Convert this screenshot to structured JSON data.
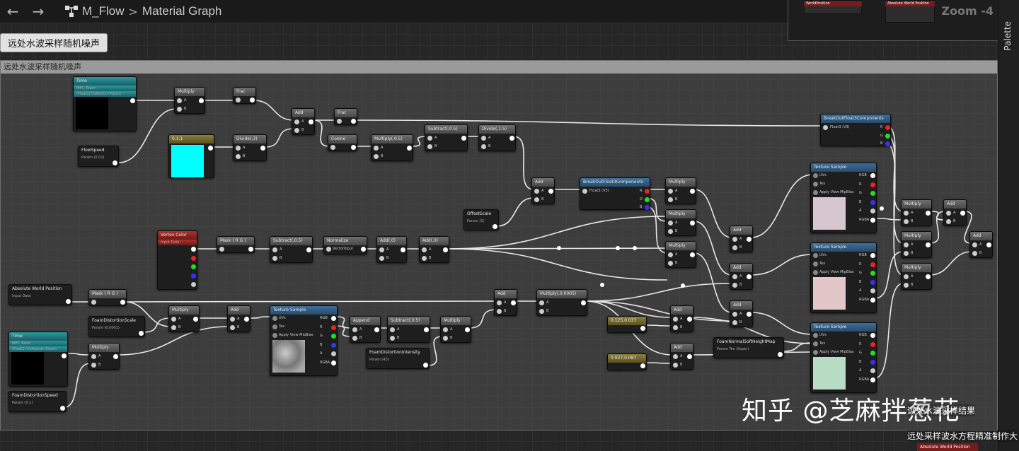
{
  "header": {
    "back_icon": "arrow-left-icon",
    "forward_icon": "arrow-right-icon",
    "graph_icon": "material-graph-icon",
    "asset_name": "M_Flow",
    "separator": ">",
    "graph_name": "Material Graph"
  },
  "minimap": {
    "zoom": "Zoom -4",
    "node_a": "WorldPosition",
    "node_b": "Absolute World Position"
  },
  "palette": {
    "label": "Palette"
  },
  "bookmark": {
    "label": "远处水波采样随机噪声"
  },
  "comment": {
    "title": "远处水波采样随机噪声"
  },
  "nodes": {
    "time1": {
      "title": "Time",
      "sub": "MPC_River",
      "sub2": "(Float1) Collection Param"
    },
    "flowspeed": {
      "title": "FlowSpeed",
      "sub": "Param (0.01)"
    },
    "color1": {
      "title": "0,1,1"
    },
    "multiply1": {
      "title": "Multiply",
      "a": "A",
      "b": "B"
    },
    "frac1": {
      "title": "Frac"
    },
    "divide1": {
      "title": "Divide(,3)",
      "a": "A",
      "b": "B"
    },
    "add1": {
      "title": "Add",
      "a": "A",
      "b": "B"
    },
    "frac2": {
      "title": "Frac"
    },
    "cosine": {
      "title": "Cosine"
    },
    "multiply05": {
      "title": "Multiply(,0.5)",
      "a": "A",
      "b": "B"
    },
    "subtract05": {
      "title": "Subtract(,0.5)",
      "a": "A",
      "b": "B"
    },
    "divide15": {
      "title": "Divide(,1.5)",
      "a": "A",
      "b": "B"
    },
    "add2": {
      "title": "Add",
      "a": "A",
      "b": "B"
    },
    "offsetscale": {
      "title": "OffsetScale",
      "sub": "Param (1)"
    },
    "breakout1": {
      "title": "BreakOutFloat3Components",
      "in": "Float3 (V3)",
      "r": "R",
      "g": "G",
      "b": "B"
    },
    "breakout2": {
      "title": "BreakOutFloat3Components",
      "in": "Float3 (V3)",
      "r": "R",
      "g": "G",
      "b": "B"
    },
    "vertexcolor": {
      "title": "Vertex Color",
      "sub": "Input Data"
    },
    "maskrg": {
      "title": "Mask ( R G )"
    },
    "subtract05b": {
      "title": "Subtract(,0.5)",
      "a": "A",
      "b": "B"
    },
    "normalize": {
      "title": "Normalize",
      "in": "VectorInput"
    },
    "add0a": {
      "title": "Add(,0)",
      "a": "A",
      "b": "B"
    },
    "add0b": {
      "title": "Add(,0)",
      "a": "A",
      "b": "B"
    },
    "multiply_r1": {
      "title": "Multiply",
      "a": "A",
      "b": "B"
    },
    "multiply_r2": {
      "title": "Multiply",
      "a": "A",
      "b": "B"
    },
    "multiply_r3": {
      "title": "Multiply",
      "a": "A",
      "b": "B"
    },
    "add_r1": {
      "title": "Add",
      "a": "A",
      "b": "B"
    },
    "add_r2": {
      "title": "Add",
      "a": "A",
      "b": "B"
    },
    "add_r3": {
      "title": "Add",
      "a": "A",
      "b": "B"
    },
    "tex1": {
      "title": "Texture Sample",
      "uvs": "UVs",
      "tex": "Tex",
      "mip": "Apply View MipBias",
      "rgb": "RGB",
      "r": "R",
      "g": "G",
      "b": "B",
      "a": "A",
      "rgba": "RGBA"
    },
    "tex2": {
      "title": "Texture Sample",
      "uvs": "UVs",
      "tex": "Tex",
      "mip": "Apply View MipBias",
      "rgb": "RGB",
      "r": "R",
      "g": "G",
      "b": "B",
      "a": "A",
      "rgba": "RGBA"
    },
    "tex3": {
      "title": "Texture Sample",
      "uvs": "UVs",
      "tex": "Tex",
      "mip": "Apply View MipBias",
      "rgb": "RGB",
      "r": "R",
      "g": "G",
      "b": "B",
      "a": "A",
      "rgba": "RGBA"
    },
    "texfoam": {
      "title": "Texture Sample",
      "uvs": "UVs",
      "tex": "Tex",
      "mip": "Apply View MipBias",
      "rgb": "RGB",
      "r": "R",
      "g": "G",
      "b": "B",
      "a": "A",
      "rgba": "RGBA"
    },
    "multiply_f1": {
      "title": "Multiply",
      "a": "A",
      "b": "B"
    },
    "multiply_f2": {
      "title": "Multiply",
      "a": "A",
      "b": "B"
    },
    "multiply_f3": {
      "title": "Multiply",
      "a": "A",
      "b": "B"
    },
    "add_f1": {
      "title": "Add",
      "a": "A",
      "b": "B"
    },
    "add_f2": {
      "title": "Add",
      "a": "A",
      "b": "B"
    },
    "absworld": {
      "title": "Absolute World Position",
      "sub": "Input Data"
    },
    "maskrg2": {
      "title": "Mask ( R G )"
    },
    "foamscale": {
      "title": "FoamDistortionScale",
      "sub": "Param (0.0001)"
    },
    "multiply_b1": {
      "title": "Multiply",
      "a": "A",
      "b": "B"
    },
    "add_b1": {
      "title": "Add",
      "a": "A",
      "b": "B"
    },
    "time2": {
      "title": "Time",
      "sub": "MPC_River",
      "sub2": "(Float1) Collection Param"
    },
    "multiply_b2": {
      "title": "Multiply",
      "a": "A",
      "b": "B"
    },
    "foamspeed": {
      "title": "FoamDistortionSpeed",
      "sub": "Param (0.1)"
    },
    "append": {
      "title": "Append",
      "a": "A",
      "b": "B"
    },
    "subtract05c": {
      "title": "Subtract(,0.5)",
      "a": "A",
      "b": "B"
    },
    "multiply_b3": {
      "title": "Multiply",
      "a": "A",
      "b": "B"
    },
    "foamintensity": {
      "title": "FoamDistortionIntensity",
      "sub": "Param (43)"
    },
    "add_m": {
      "title": "Add",
      "a": "A",
      "b": "B"
    },
    "multiply_0005": {
      "title": "Multiply(,0.0005)",
      "a": "A",
      "b": "B"
    },
    "const1": {
      "title": "0.125,0.037"
    },
    "const2": {
      "title": "0.027,0.087"
    },
    "add_c1": {
      "title": "Add",
      "a": "A",
      "b": "B"
    },
    "add_c2": {
      "title": "Add",
      "a": "A",
      "b": "B"
    },
    "foamheightmap": {
      "title": "FoamNormalSoftHeightMap",
      "sub": "Param Tex (Ssper)"
    }
  },
  "overlay": {
    "watermark": "知乎 @芝麻拌葱花",
    "bottom_text_1": "远处水波采样结果",
    "bottom_text_2": "远处采样波水方程精准制作大",
    "bottom_node": "Absolute World Position"
  },
  "colors": {
    "pin_r": "#e22",
    "pin_g": "#2d2",
    "pin_b": "#33f",
    "swatch_cyan": "#00ffff",
    "swatch_tex1": "#d6c7cf",
    "swatch_tex2": "#e2c6c8",
    "swatch_tex3": "#b9dcc4"
  }
}
